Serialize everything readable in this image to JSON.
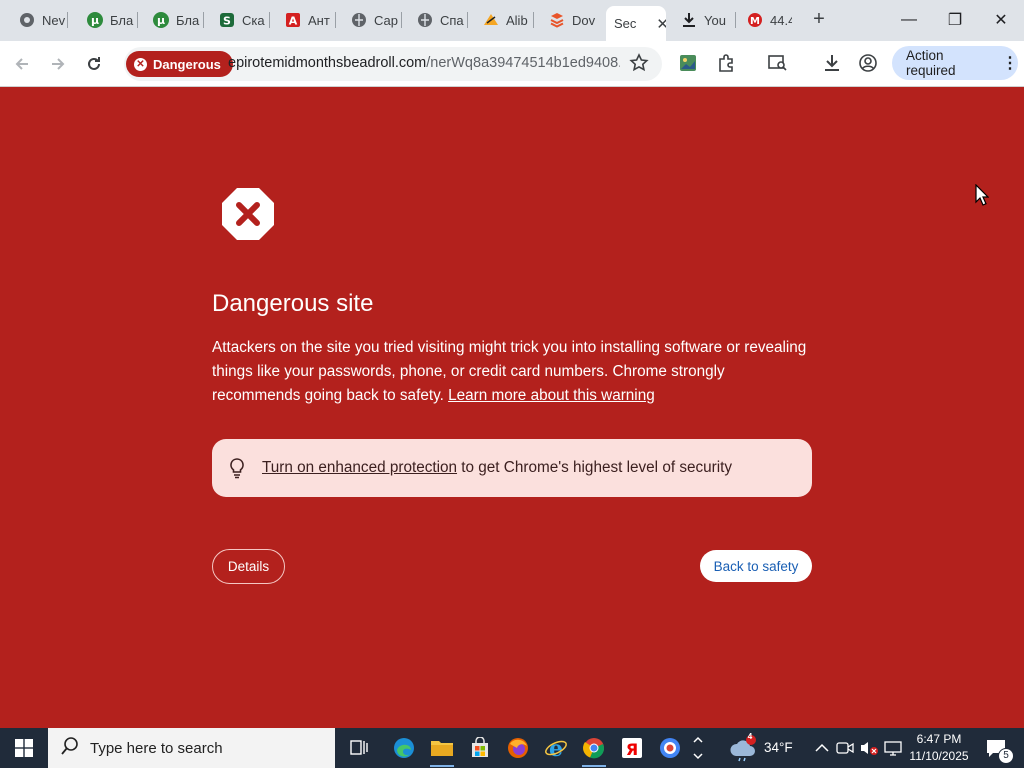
{
  "tabs": [
    {
      "label": "Nev"
    },
    {
      "label": "Бла"
    },
    {
      "label": "Бла"
    },
    {
      "label": "Ска"
    },
    {
      "label": "Ант"
    },
    {
      "label": "Сар"
    },
    {
      "label": "Спа"
    },
    {
      "label": "Alib"
    },
    {
      "label": "Dov"
    },
    {
      "label": "Sec"
    },
    {
      "label": "You"
    },
    {
      "label": "44.4"
    }
  ],
  "window_controls": {
    "minimize": "—",
    "restore": "❐",
    "close": "✕"
  },
  "omnibox": {
    "chip_label": "Dangerous",
    "url_host": "epirotemidmonthsbeadroll.com",
    "url_path": "/nerWq8a39474514b1ed9408..."
  },
  "toolbar": {
    "action_required": "Action required"
  },
  "page": {
    "title": "Dangerous site",
    "desc_text": "Attackers on the site you tried visiting might trick you into installing software or revealing things like your passwords, phone, or credit card numbers. Chrome strongly recommends going back to safety. ",
    "learn_more": "Learn more about this warning",
    "promo_link": "Turn on enhanced protection",
    "promo_rest": " to get Chrome's highest level of security",
    "details_button": "Details",
    "back_button": "Back to safety"
  },
  "taskbar": {
    "search_placeholder": "Type here to search",
    "weather_temp": "34°F",
    "weather_badge": "4",
    "time": "6:47 PM",
    "date": "11/10/2025",
    "notifications": "5"
  },
  "colors": {
    "danger": "#b3211d",
    "promo_bg": "#fbe0dd",
    "taskbar": "#202b3a"
  }
}
